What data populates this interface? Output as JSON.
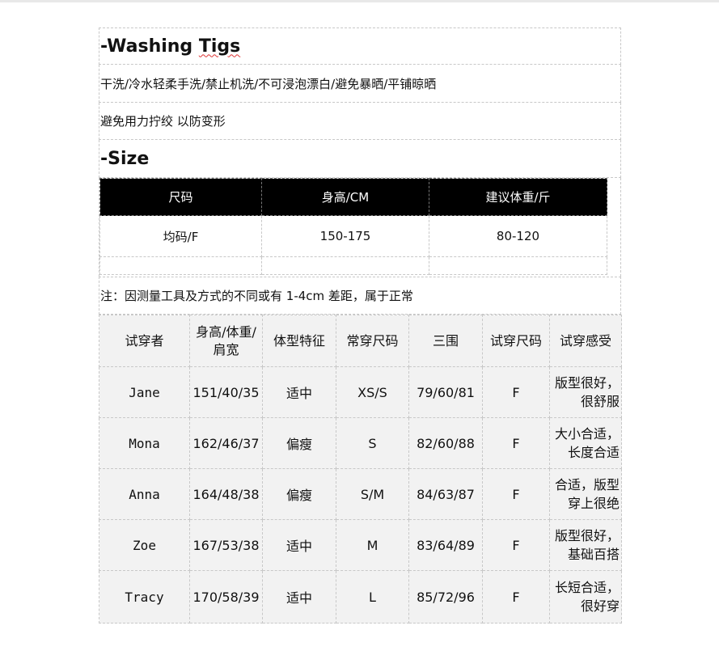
{
  "washing": {
    "title_prefix": "-Washing ",
    "title_word": "Tigs",
    "line1": "干洗/冷水轻柔手洗/禁止机洗/不可浸泡漂白/避免暴晒/平铺晾晒",
    "line2": "避免用力拧绞 以防变形"
  },
  "size": {
    "title": "-Size",
    "headers": [
      "尺码",
      "身高/CM",
      "建议体重/斤"
    ],
    "values": [
      "均码/F",
      "150-175",
      "80-120"
    ]
  },
  "note": "注：因测量工具及方式的不同或有 1-4cm 差距，属于正常",
  "fitting": {
    "headers": [
      "试穿者",
      "身高/体重/\n肩宽",
      "体型特征",
      "常穿尺码",
      "三围",
      "试穿尺码",
      "试穿感受"
    ],
    "rows": [
      [
        "Jane",
        "151/40/35",
        "适中",
        "XS/S",
        "79/60/81",
        "F",
        "版型很好，\n很舒服"
      ],
      [
        "Mona",
        "162/46/37",
        "偏瘦",
        "S",
        "82/60/88",
        "F",
        "大小合适，\n长度合适"
      ],
      [
        "Anna",
        "164/48/38",
        "偏瘦",
        "S/M",
        "84/63/87",
        "F",
        "合适，版型\n穿上很绝"
      ],
      [
        "Zoe",
        "167/53/38",
        "适中",
        "M",
        "83/64/89",
        "F",
        "版型很好，\n基础百搭"
      ],
      [
        "Tracy",
        "170/58/39",
        "适中",
        "L",
        "85/72/96",
        "F",
        "长短合适，\n很好穿"
      ]
    ]
  }
}
